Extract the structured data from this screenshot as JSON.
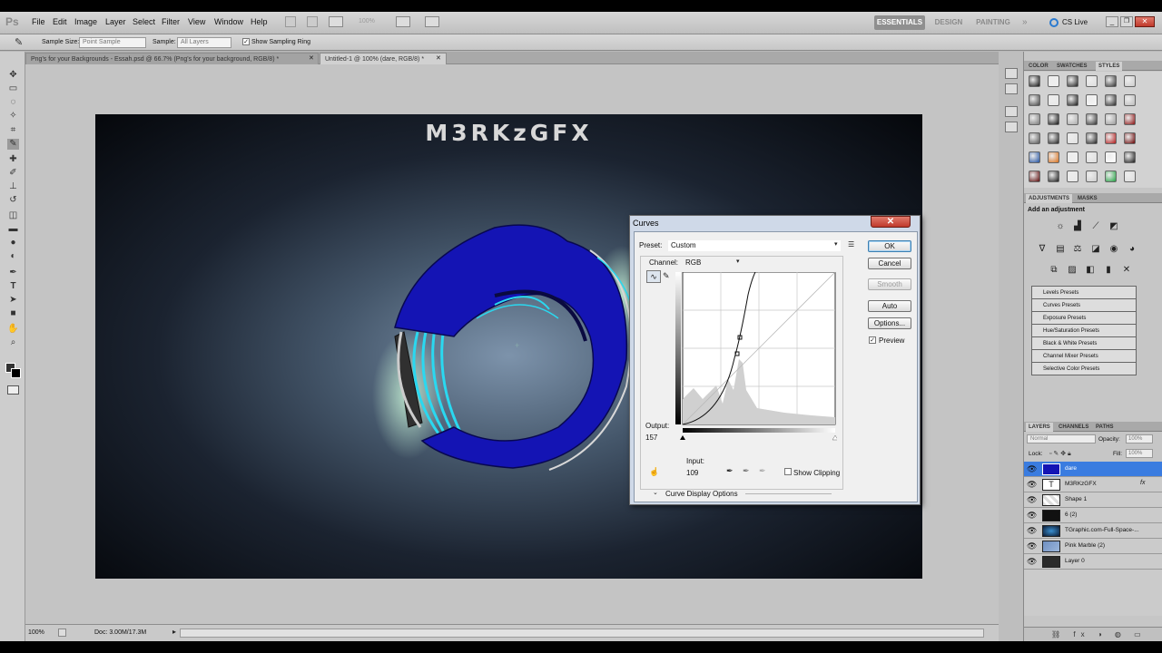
{
  "app": {
    "logo": "Ps",
    "menu": [
      "File",
      "Edit",
      "Image",
      "Layer",
      "Select",
      "Filter",
      "View",
      "Window",
      "Help"
    ],
    "zoom_display": "100%",
    "workspaces": [
      "ESSENTIALS",
      "DESIGN",
      "PAINTING"
    ],
    "cs_live": "CS Live"
  },
  "options_bar": {
    "sample_size_label": "Sample Size:",
    "sample_size_value": "Point Sample",
    "sample_label": "Sample:",
    "sample_value": "All Layers",
    "show_ring_label": "Show Sampling Ring"
  },
  "tabs": [
    {
      "label": "Png's for your Backgrounds - Essah.psd @ 66.7% (Png's for your background, RGB/8) *"
    },
    {
      "label": "Untitled-1 @ 100% (dare, RGB/8) *"
    }
  ],
  "canvas": {
    "title_text": "M3RKzGFX"
  },
  "curves": {
    "title": "Curves",
    "preset_label": "Preset:",
    "preset_value": "Custom",
    "channel_label": "Channel:",
    "channel_value": "RGB",
    "output_label": "Output:",
    "output_value": "157",
    "input_label": "Input:",
    "input_value": "109",
    "show_clipping": "Show Clipping",
    "display_options": "Curve Display Options",
    "buttons": {
      "ok": "OK",
      "cancel": "Cancel",
      "smooth": "Smooth",
      "auto": "Auto",
      "options": "Options..."
    },
    "preview_label": "Preview"
  },
  "status": {
    "zoom": "100%",
    "doc": "Doc: 3.00M/17.3M"
  },
  "panels": {
    "top_tabs": [
      "COLOR",
      "SWATCHES",
      "STYLES"
    ],
    "adj_tabs": [
      "ADJUSTMENTS",
      "MASKS"
    ],
    "adj_heading": "Add an adjustment",
    "presets": [
      "Levels Presets",
      "Curves Presets",
      "Exposure Presets",
      "Hue/Saturation Presets",
      "Black & White Presets",
      "Channel Mixer Presets",
      "Selective Color Presets"
    ],
    "layer_tabs": [
      "LAYERS",
      "CHANNELS",
      "PATHS"
    ],
    "blend_mode": "Normal",
    "opacity_label": "Opacity:",
    "opacity_value": "100%",
    "lock_label": "Lock:",
    "fill_label": "Fill:",
    "fill_value": "100%",
    "layers": [
      {
        "name": "dare"
      },
      {
        "name": "M3RKzGFX"
      },
      {
        "name": "Shape 1"
      },
      {
        "name": "6 (2)"
      },
      {
        "name": "TGraphic.com-Full-Space-..."
      },
      {
        "name": "Pink Marble (2)"
      },
      {
        "name": "Layer 0"
      }
    ]
  },
  "colors": {
    "accent": "#3a7ce0",
    "logo_blue": "#1414b4",
    "logo_cyan": "#2ad8f0"
  }
}
